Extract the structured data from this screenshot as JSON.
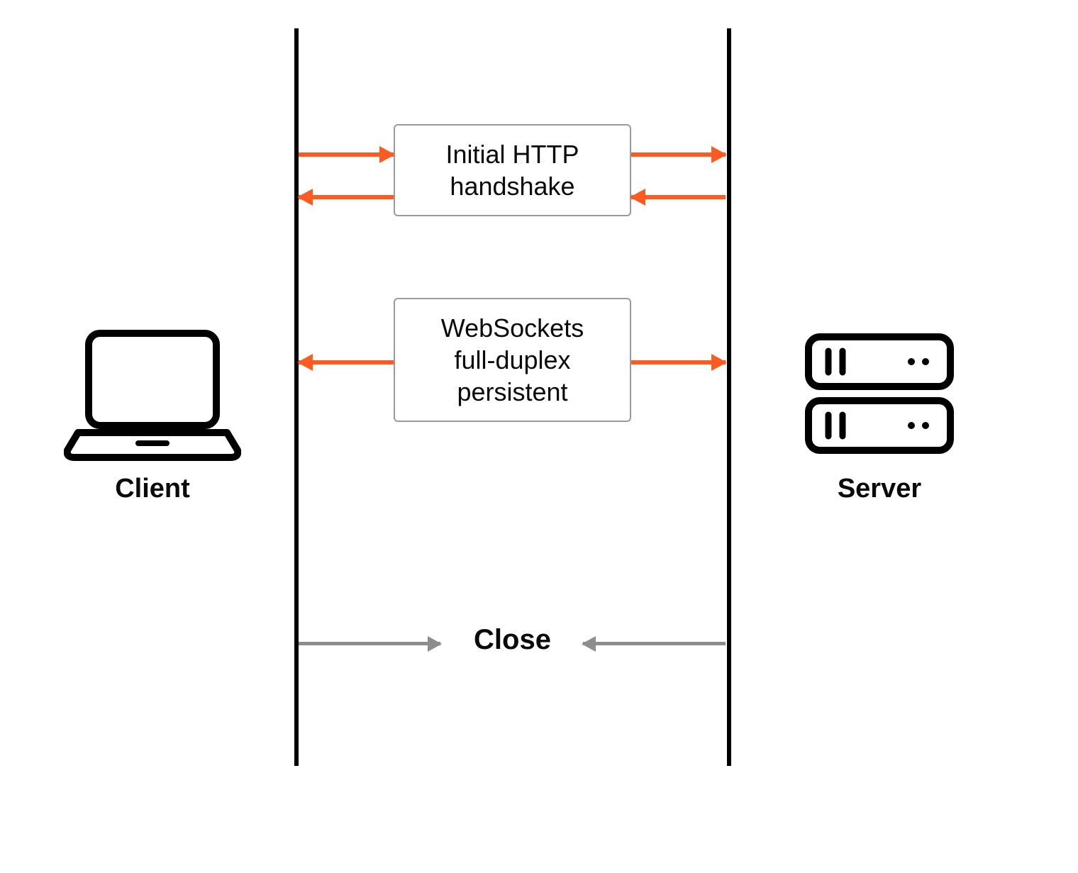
{
  "diagram": {
    "client_label": "Client",
    "server_label": "Server",
    "handshake_line1": "Initial HTTP",
    "handshake_line2": "handshake",
    "persistent_line1": "WebSockets",
    "persistent_line2": "full-duplex",
    "persistent_line3": "persistent",
    "close_label": "Close",
    "colors": {
      "arrow_active": "#ff5a1f",
      "arrow_close": "#8d8d8d",
      "line": "#000000",
      "box_border": "#9a9a9a"
    }
  }
}
